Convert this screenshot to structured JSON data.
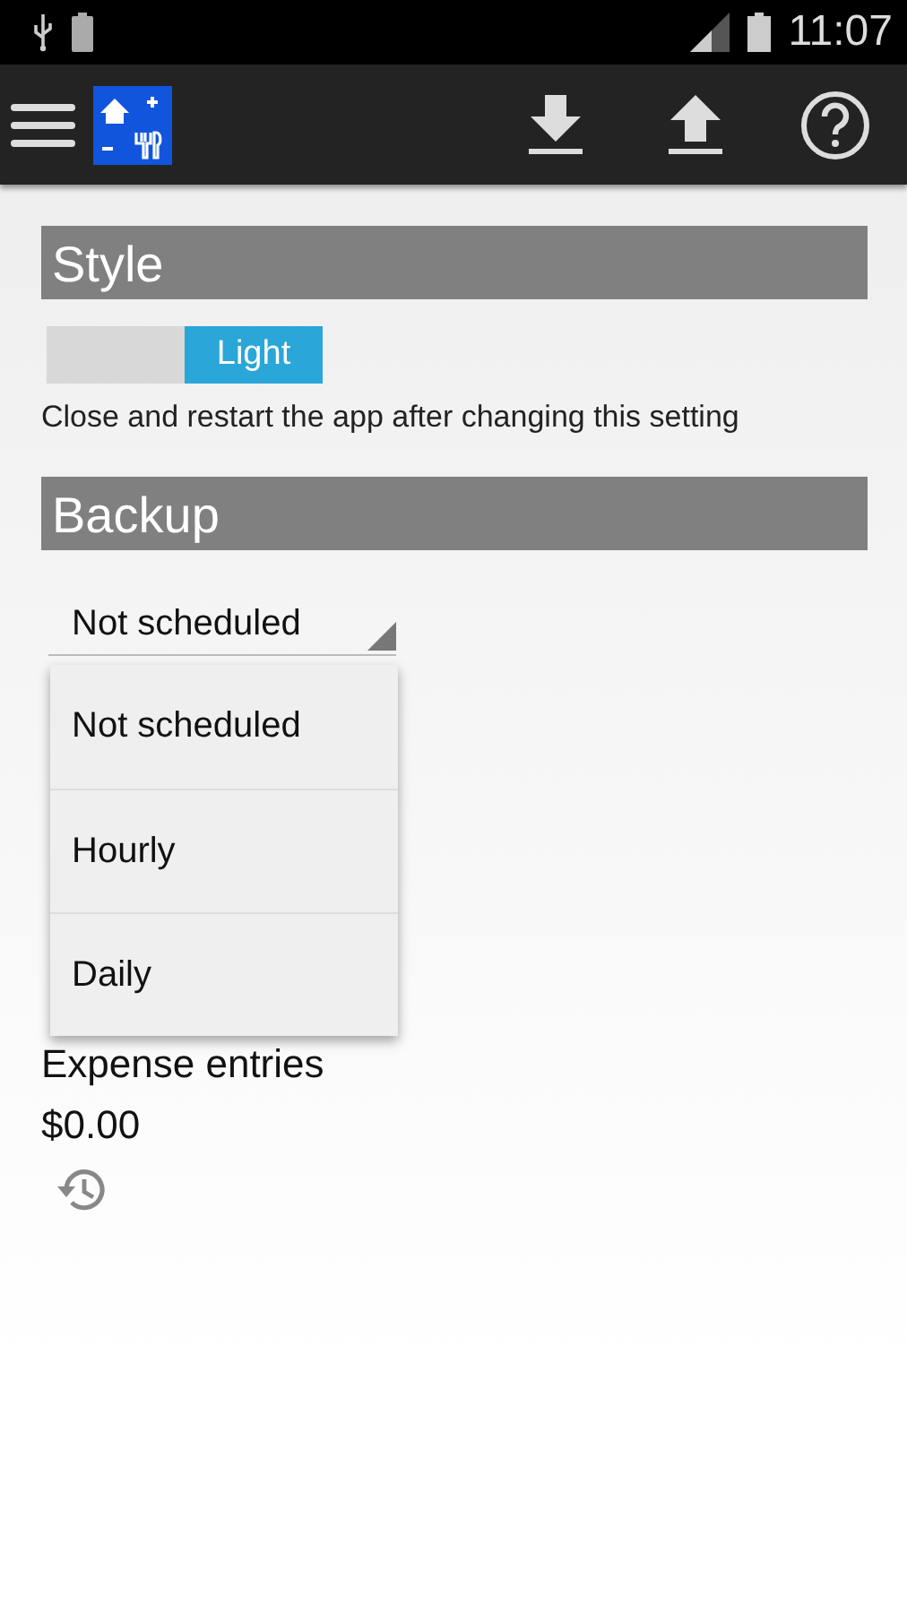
{
  "status_bar": {
    "time": "11:07"
  },
  "style": {
    "header": "Style",
    "toggle": {
      "label": "Light",
      "on": true
    },
    "hint": "Close and restart the app after changing this setting"
  },
  "backup": {
    "header": "Backup",
    "schedule": {
      "value": "Not scheduled",
      "expanded": true,
      "options": [
        {
          "label": "Not scheduled"
        },
        {
          "label": "Hourly"
        },
        {
          "label": "Daily"
        }
      ]
    }
  },
  "expenses": {
    "label": "Expense entries",
    "amount": "$0.00"
  }
}
